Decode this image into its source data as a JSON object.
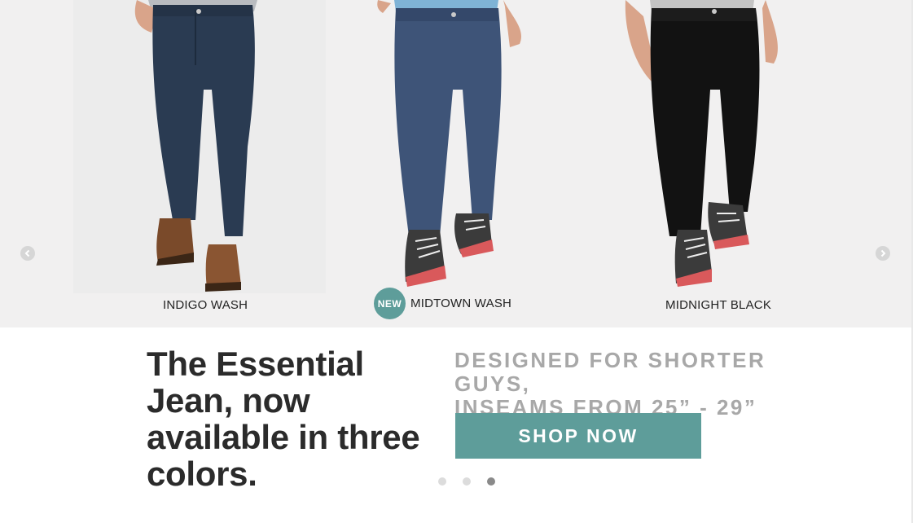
{
  "products": [
    {
      "name": "INDIGO WASH",
      "color": "#2a3b52",
      "shoe": "brown-boot"
    },
    {
      "name": "MIDTOWN WASH",
      "color": "#3e5478",
      "shoe": "sneaker",
      "badge": "NEW"
    },
    {
      "name": "MIDNIGHT BLACK",
      "color": "#121212",
      "shoe": "sneaker"
    }
  ],
  "nav": {
    "prev_icon": "chevron-left-icon",
    "next_icon": "chevron-right-icon"
  },
  "hero": {
    "headline": "The Essential Jean, now available in three colors.",
    "subhead_line1": "DESIGNED FOR SHORTER GUYS,",
    "subhead_line2": "INSEAMS FROM 25” - 29”",
    "cta_label": "SHOP NOW"
  },
  "pagination": {
    "count": 3,
    "active_index": 2
  },
  "colors": {
    "accent": "#5e9d9a",
    "gallery_bg": "#f1f0f0",
    "headline": "#2b2b2b",
    "subhead": "#a8a8a8"
  }
}
